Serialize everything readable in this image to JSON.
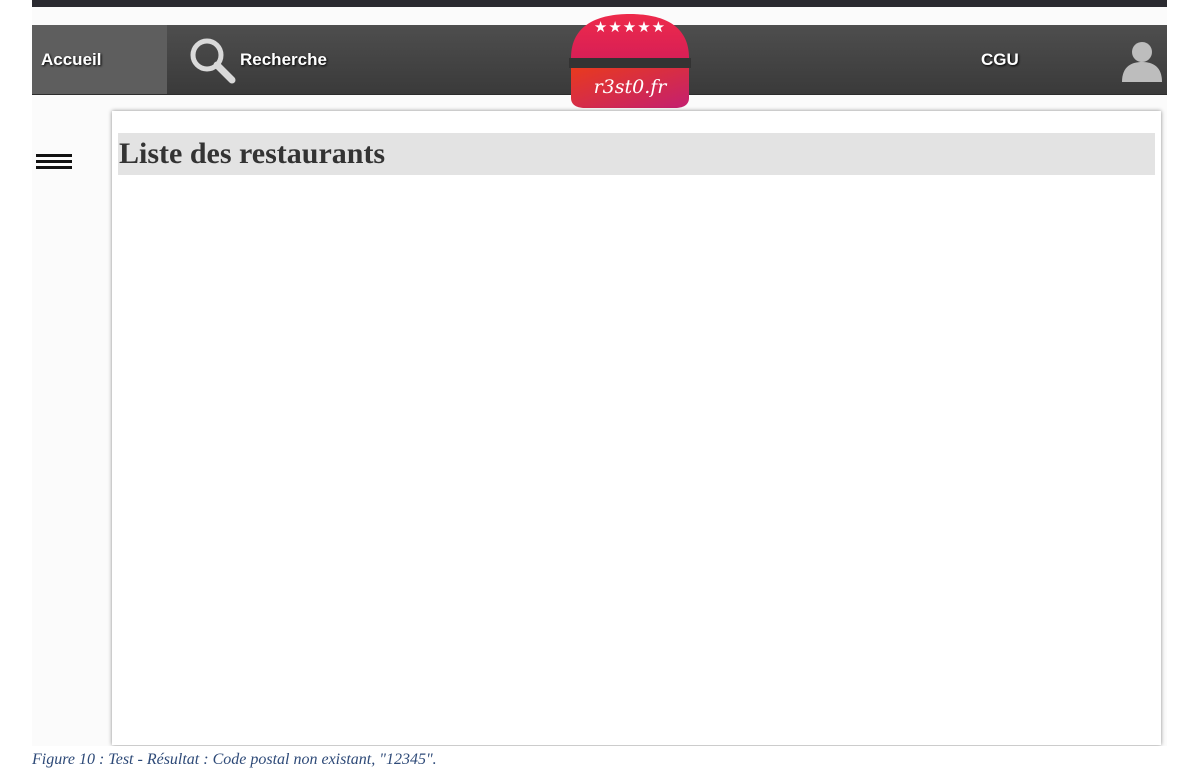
{
  "nav": {
    "home_label": "Accueil",
    "search_label": "Recherche",
    "cgu_label": "CGU",
    "search_icon": "search-icon",
    "user_icon": "user-icon"
  },
  "logo": {
    "text": "r3st0.fr",
    "stars": "★★★★★",
    "colors": {
      "top": "#e8234a",
      "bottom": "#d42058",
      "band": "#333333"
    }
  },
  "sidebar": {
    "toggle_icon": "hamburger-menu-icon"
  },
  "main": {
    "title": "Liste des restaurants"
  },
  "caption": "Figure 10 : Test - Résultat : Code postal non existant, \"12345\".",
  "colors": {
    "nav_bg": "#444444",
    "nav_home_bg": "#5e5e5e",
    "title_bar_bg": "#e3e3e3",
    "caption_text": "#2e4a78"
  }
}
